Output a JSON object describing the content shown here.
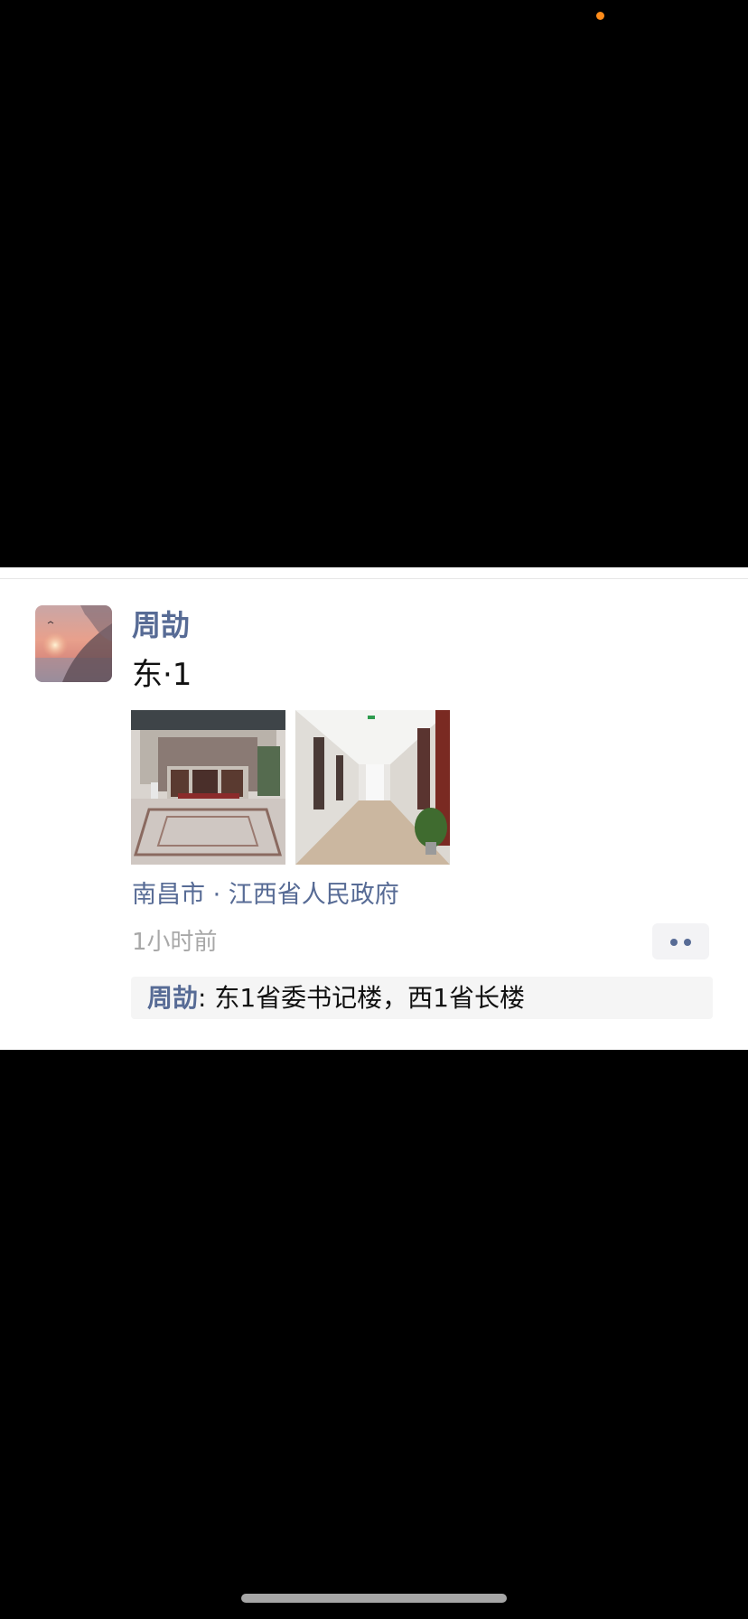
{
  "colors": {
    "link": "#576b95",
    "meta": "#a8a8a8",
    "status_dot": "#ff8c1a"
  },
  "post": {
    "username": "周劼",
    "text": "东·1",
    "images": [
      "photo-government-building-lobby",
      "photo-office-hallway"
    ],
    "location": "南昌市 · 江西省人民政府",
    "time": "1小时前",
    "more_icon": "more-dots-icon"
  },
  "comments": [
    {
      "author": "周劼",
      "separator": ": ",
      "text": "东1省委书记楼，西1省长楼"
    }
  ]
}
